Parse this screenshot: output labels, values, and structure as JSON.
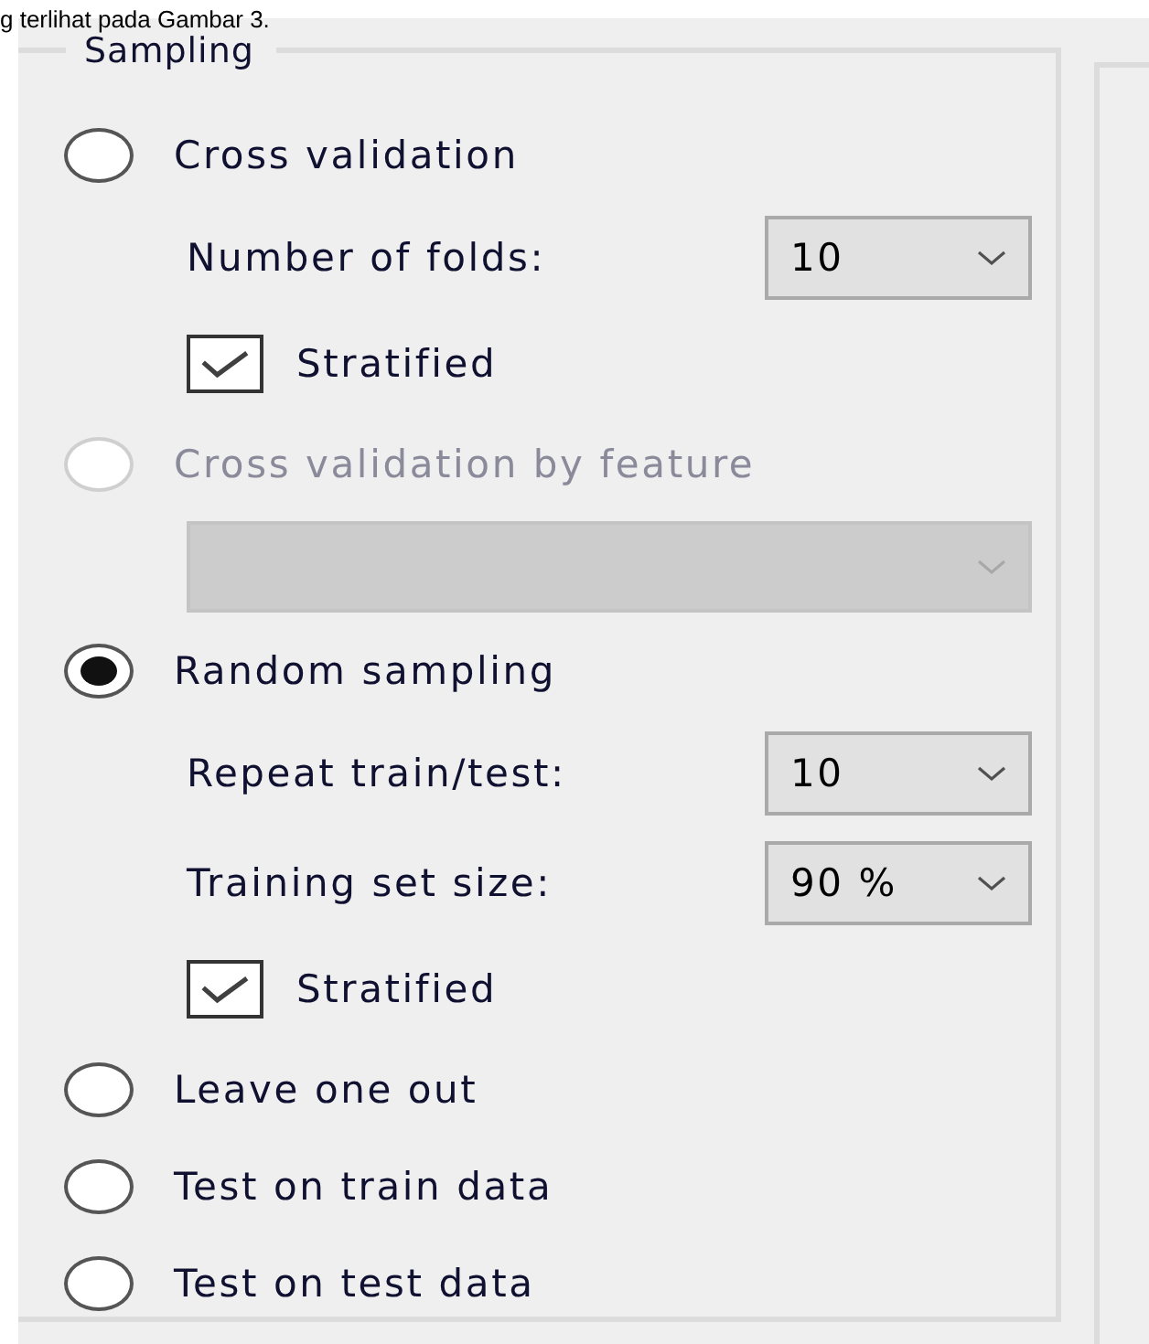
{
  "caption": "g terlihat pada Gambar 3.",
  "group": {
    "legend": "Sampling",
    "options": [
      {
        "kind": "radio",
        "label": "Cross validation",
        "selected": false,
        "disabled": false,
        "children": [
          {
            "kind": "combo",
            "label": "Number of folds:",
            "value": "10",
            "disabled": false
          },
          {
            "kind": "checkbox",
            "label": "Stratified",
            "checked": true
          }
        ]
      },
      {
        "kind": "radio",
        "label": "Cross validation by feature",
        "selected": false,
        "disabled": true,
        "children": [
          {
            "kind": "combo",
            "disabled": true
          }
        ]
      },
      {
        "kind": "radio",
        "label": "Random sampling",
        "selected": true,
        "disabled": false,
        "children": [
          {
            "kind": "combo",
            "label": "Repeat train/test:",
            "value": "10",
            "disabled": false
          },
          {
            "kind": "combo",
            "label": "Training set size:",
            "value": "90 %",
            "disabled": false
          },
          {
            "kind": "checkbox",
            "label": "Stratified",
            "checked": true
          }
        ]
      },
      {
        "kind": "radio",
        "label": "Leave one out",
        "selected": false,
        "disabled": false
      },
      {
        "kind": "radio",
        "label": "Test on train data",
        "selected": false,
        "disabled": false
      },
      {
        "kind": "radio",
        "label": "Test on test data",
        "selected": false,
        "disabled": false
      }
    ]
  }
}
